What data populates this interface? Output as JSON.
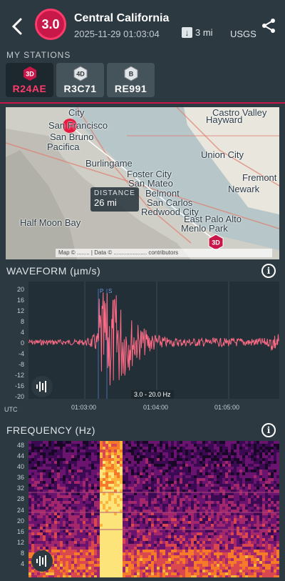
{
  "event": {
    "magnitude": "3.0",
    "title": "Central California",
    "time": "2025-11-29 01:03:04",
    "depth": "3 mi",
    "source": "USGS"
  },
  "stations": {
    "label": "MY STATIONS",
    "items": [
      {
        "badge": "3D",
        "code": "R24AE",
        "active": true
      },
      {
        "badge": "4D",
        "code": "R3C71",
        "active": false
      },
      {
        "badge": "B",
        "code": "RE991",
        "active": false
      }
    ]
  },
  "map": {
    "distance_label": "DISTANCE",
    "distance_value": "26 mi",
    "marker_badge": "3D",
    "attribution": "Map © ........ | Data © ..................... contributors",
    "places": [
      "San Francisco",
      "San Bruno",
      "Pacifica",
      "Burlingame",
      "Foster City",
      "San Mateo",
      "Belmont",
      "San Carlos",
      "Redwood City",
      "Half Moon Bay",
      "East Palo Alto",
      "Menlo Park",
      "Hayward",
      "Union City",
      "Fremont",
      "Newark",
      "City",
      "Castro Valley"
    ]
  },
  "waveform": {
    "title": "WAVEFORM (µm/s)",
    "y_ticks": [
      "20",
      "16",
      "12",
      "8",
      "4",
      "0",
      "-4",
      "-8",
      "-12",
      "-16",
      "-20"
    ],
    "x_ticks": [
      "01:03:00",
      "01:04:00",
      "01:05:00"
    ],
    "x_unit": "UTC",
    "filter": "3.0 - 20.0 Hz",
    "phase_p": "P",
    "phase_s": "S",
    "color": "#ff6b86"
  },
  "frequency": {
    "title": "FREQUENCY (Hz)",
    "y_ticks": [
      "48",
      "44",
      "40",
      "36",
      "32",
      "28",
      "24",
      "20",
      "16",
      "12",
      "8",
      "4"
    ]
  },
  "colors": {
    "accent": "#c8184a",
    "bg": "#2c3941"
  }
}
